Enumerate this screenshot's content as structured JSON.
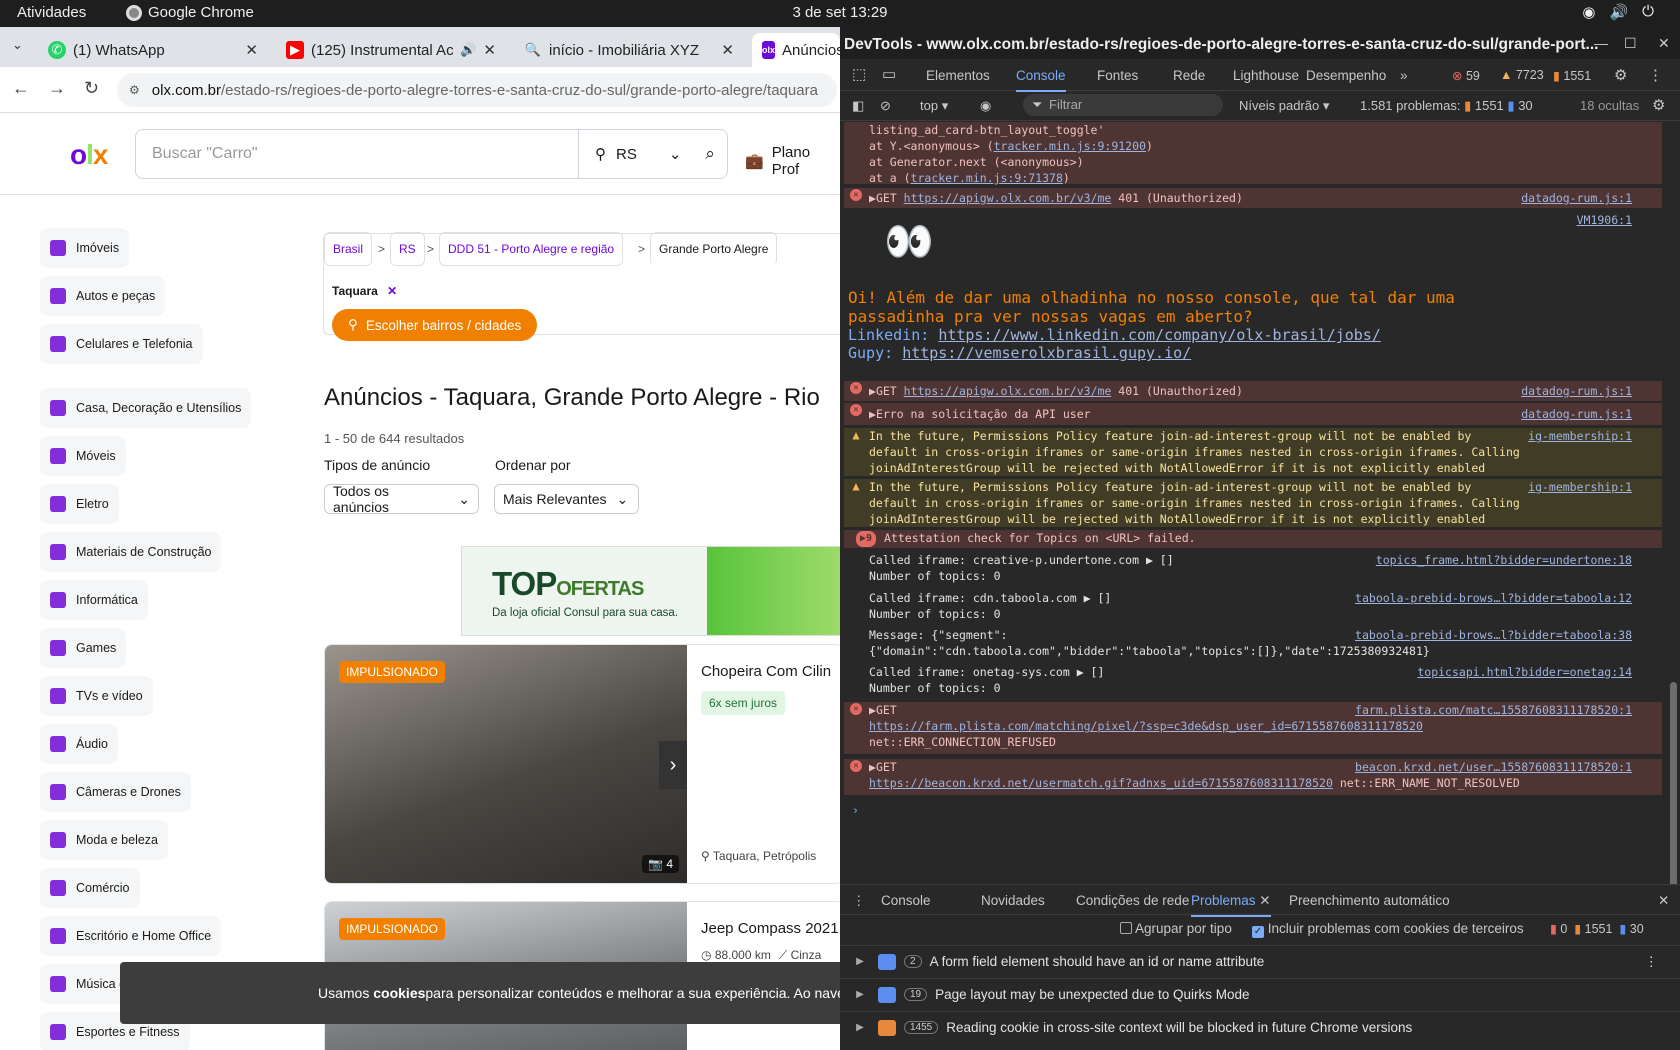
{
  "os_bar": {
    "activities": "Atividades",
    "app_name": "Google Chrome",
    "clock": "3 de set  13:29"
  },
  "browser": {
    "tabs": [
      {
        "title": "(1) WhatsApp"
      },
      {
        "title": "(125) Instrumental Ac"
      },
      {
        "title": "início - Imobiliária XYZ"
      },
      {
        "title": "Anúncios"
      }
    ],
    "url_host": "olx.com.br",
    "url_path": "/estado-rs/regioes-de-porto-alegre-torres-e-santa-cruz-do-sul/grande-porto-alegre/taquara"
  },
  "olx": {
    "logo": "olx",
    "search_placeholder": "Buscar \"Carro\"",
    "state": "RS",
    "plano_link": "Plano Prof",
    "categories": [
      "Imóveis",
      "Autos e peças",
      "Celulares e Telefonia",
      "Casa, Decoração e Utensílios",
      "Móveis",
      "Eletro",
      "Materiais de Construção",
      "Informática",
      "Games",
      "TVs e vídeo",
      "Áudio",
      "Câmeras e Drones",
      "Moda e beleza",
      "Comércio",
      "Escritório e Home Office",
      "Música e",
      "Esportes e Fitness"
    ],
    "breadcrumbs": [
      "Brasil",
      "RS",
      "DDD 51 - Porto Alegre e região",
      "Grande Porto Alegre"
    ],
    "crumb_sep": ">",
    "active_filter": "Taquara",
    "choose_button": "Escolher bairros / cidades",
    "heading": "Anúncios - Taquara, Grande Porto Alegre - Rio",
    "result_count": "1 - 50 de 644 resultados",
    "ad_type_label": "Tipos de anúncio",
    "ad_type_value": "Todos os anúncios",
    "sort_label": "Ordenar por",
    "sort_value": "Mais Relevantes",
    "banner": {
      "brand_top": "TOP",
      "brand_rest": "OFERTAS",
      "tagline": "Da loja oficial Consul para sua casa."
    },
    "listings": [
      {
        "badge": "IMPULSIONADO",
        "title": "Chopeira Com Cilin",
        "installments": "6x sem juros",
        "photos": "4",
        "location": "Taquara, Petrópolis"
      },
      {
        "badge": "IMPULSIONADO",
        "title": "Jeep Compass 2021",
        "km": "88.000 km",
        "color": "Cinza"
      }
    ],
    "cookie_text_pre": "Usamos ",
    "cookie_text_bold": "cookies",
    "cookie_text_post": " para personalizar conteúdos e melhorar a sua experiência. Ao nave"
  },
  "devtools": {
    "title": "DevTools - www.olx.com.br/estado-rs/regioes-de-porto-alegre-torres-e-santa-cruz-do-sul/grande-port...",
    "tabs": [
      "Elementos",
      "Console",
      "Fontes",
      "Rede",
      "Lighthouse",
      "Desempenho"
    ],
    "error_count": "59",
    "warning_count": "7723",
    "issue_count": "1551",
    "context": "top",
    "filter_placeholder": "Filtrar",
    "levels": "Níveis padrão",
    "problems_summary": "1.581 problemas:",
    "problems_red": "1551",
    "problems_blue": "30",
    "hidden": "18 ocultas",
    "console": {
      "stack": [
        "listing_ad_card-btn_layout_toggle'",
        "    at Y.<anonymous> (",
        "    at Generator.next (<anonymous>)",
        "    at a ("
      ],
      "stack_links": [
        "tracker.min.js:9:91200",
        "tracker.min.js:9:71378"
      ],
      "get1_prefix": "GET ",
      "get1_url": "https://apigw.olx.com.br/v3/me",
      "get1_status": " 401 (Unauthorized)",
      "src_datadog": "datadog-rum.js:1",
      "vm_src": "VM1906:1",
      "eyes": "👀",
      "promo_line1": " Oi! Além de dar uma olhadinha no nosso console, que tal dar uma",
      "promo_line2": "passadinha pra ver nossas vagas em aberto?",
      "linkedin_label": " Linkedin: ",
      "linkedin_url": "https://www.linkedin.com/company/olx-brasil/jobs/",
      "gupy_label": " Gupy: ",
      "gupy_url": "https://vemserolxbrasil.gupy.io/",
      "api_error": "Erro na solicitação da API user",
      "warn_line1": "In the future, Permissions Policy feature join-ad-interest-group will not be enabled by",
      "warn_line2": "default in cross-origin iframes or same-origin iframes nested in cross-origin iframes. Calling",
      "warn_line3": "joinAdInterestGroup will be rejected with NotAllowedError if it is not explicitly enabled",
      "warn_src": "ig-membership:1",
      "attest_count": "9",
      "attest_text": "Attestation check for Topics on <URL> failed.",
      "topics": [
        {
          "l1": "Called iframe: creative-p.undertone.com  ▶ []",
          "l2": "Number of topics:  0",
          "src": "topics_frame.html?bidder=undertone:18"
        },
        {
          "l1": "Called iframe: cdn.taboola.com  ▶ []",
          "l2": "Number of topics:  0",
          "src": "taboola-prebid-brows…l?bidder=taboola:12"
        },
        {
          "l1": "Message: {\"segment\":",
          "l2": "{\"domain\":\"cdn.taboola.com\",\"bidder\":\"taboola\",\"topics\":[]},\"date\":1725380932481}",
          "src": "taboola-prebid-brows…l?bidder=taboola:38"
        },
        {
          "l1": "Called iframe: onetag-sys.com  ▶ []",
          "l2": "Number of topics:  0",
          "src": "topicsapi.html?bidder=onetag:14"
        }
      ],
      "plista_src": "farm.plista.com/matc…15587608311178520:1",
      "plista_url": "https://farm.plista.com/matching/pixel/?ssp=c3de&dsp_user_id=6715587608311178520",
      "plista_err": "net::ERR_CONNECTION_REFUSED",
      "krxd_src": "beacon.krxd.net/user…15587608311178520:1",
      "krxd_url": "https://beacon.krxd.net/usermatch.gif?adnxs_uid=6715587608311178520",
      "krxd_err": " net::ERR_NAME_NOT_RESOLVED"
    },
    "drawer_tabs": [
      "Console",
      "Novidades",
      "Condições de rede",
      "Problemas",
      "Preenchimento automático"
    ],
    "group_by_type": "Agrupar por tipo",
    "third_party": "Incluir problemas com cookies de terceiros",
    "drawer_counts": [
      "0",
      "1551",
      "30"
    ],
    "issues": [
      {
        "count": "2",
        "text": "A form field element should have an id or name attribute"
      },
      {
        "count": "19",
        "text": "Page layout may be unexpected due to Quirks Mode"
      },
      {
        "count": "1455",
        "text": "Reading cookie in cross-site context will be blocked in future Chrome versions"
      }
    ]
  }
}
